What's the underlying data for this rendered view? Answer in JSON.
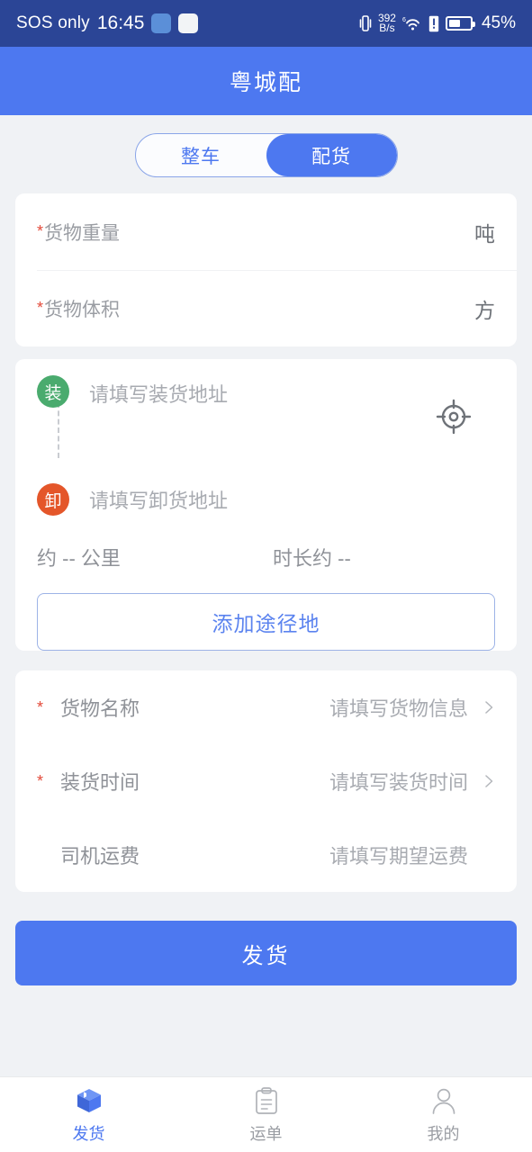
{
  "status_bar": {
    "carrier": "SOS only",
    "time": "16:45",
    "app_icons": [
      "app-badge-icon",
      "app-badge-icon"
    ],
    "vibrate_icon": "vibrate-icon",
    "net_speed_value": "392",
    "net_speed_unit": "B/s",
    "wifi_icon": "wifi-6-icon",
    "sim_alert_icon": "sim-alert-icon",
    "battery_icon": "battery-icon",
    "battery_percent": "45%"
  },
  "header": {
    "title": "粤城配"
  },
  "segmented": {
    "options": [
      {
        "label": "整车",
        "active": false
      },
      {
        "label": "配货",
        "active": true
      }
    ]
  },
  "cargo_card": {
    "rows": [
      {
        "required": "*",
        "label": "货物重量",
        "unit": "吨",
        "value": ""
      },
      {
        "required": "*",
        "label": "货物体积",
        "unit": "方",
        "value": ""
      }
    ]
  },
  "address_card": {
    "pickup": {
      "badge": "装",
      "placeholder": "请填写装货地址",
      "value": "",
      "badge_color": "#4aab6e"
    },
    "dropoff": {
      "badge": "卸",
      "placeholder": "请填写卸货地址",
      "value": "",
      "badge_color": "#e4562a"
    },
    "locate_icon": "locate-crosshair-icon",
    "distance": "约 -- 公里",
    "duration": "时长约 --",
    "add_waypoint_label": "添加途径地"
  },
  "detail_card": {
    "rows": [
      {
        "required": "*",
        "label": "货物名称",
        "value": "请填写货物信息",
        "chevron": true
      },
      {
        "required": "*",
        "label": "装货时间",
        "value": "请填写装货时间",
        "chevron": true
      },
      {
        "required": "",
        "label": "司机运费",
        "value": "请填写期望运费",
        "chevron": false
      }
    ]
  },
  "submit": {
    "label": "发货"
  },
  "tabbar": {
    "items": [
      {
        "label": "发货",
        "icon": "cube-box-icon",
        "active": true
      },
      {
        "label": "运单",
        "icon": "clipboard-icon",
        "active": false
      },
      {
        "label": "我的",
        "icon": "person-icon",
        "active": false
      }
    ]
  },
  "colors": {
    "brand_blue": "#4d78f0",
    "status_bar_blue": "#2b4596",
    "page_bg": "#f0f2f5",
    "required_red": "#e34a3a",
    "load_green": "#4aab6e",
    "unload_orange": "#e4562a"
  }
}
